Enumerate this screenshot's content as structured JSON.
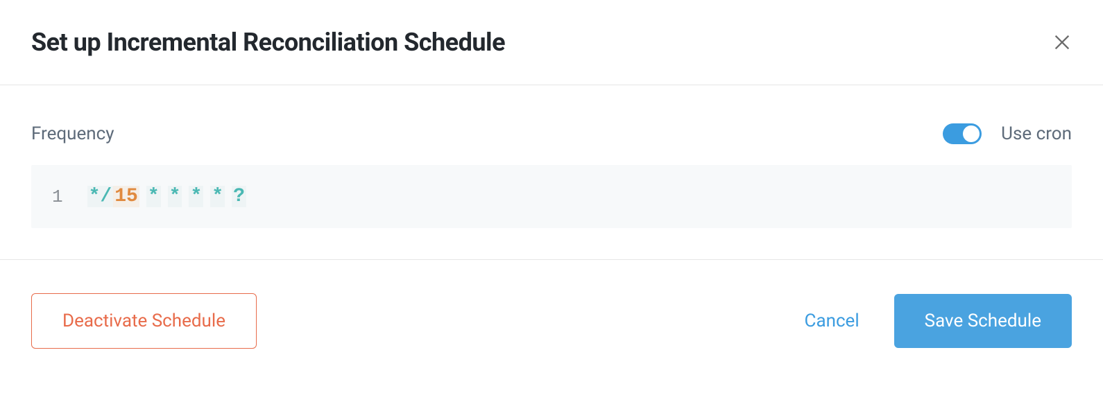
{
  "header": {
    "title": "Set up Incremental Reconciliation Schedule"
  },
  "body": {
    "frequency_label": "Frequency",
    "use_cron_label": "Use cron",
    "use_cron_on": true,
    "cron_line_number": "1",
    "cron_tokens": [
      {
        "text": "*/",
        "cls": "cron-tok-teal"
      },
      {
        "text": "15",
        "cls": "cron-tok-orange"
      },
      {
        "text": "*",
        "cls": "cron-tok-teal"
      },
      {
        "text": "*",
        "cls": "cron-tok-teal"
      },
      {
        "text": "*",
        "cls": "cron-tok-teal"
      },
      {
        "text": "*",
        "cls": "cron-tok-teal"
      },
      {
        "text": "?",
        "cls": "cron-tok-teal"
      }
    ]
  },
  "footer": {
    "deactivate_label": "Deactivate Schedule",
    "cancel_label": "Cancel",
    "save_label": "Save Schedule"
  }
}
